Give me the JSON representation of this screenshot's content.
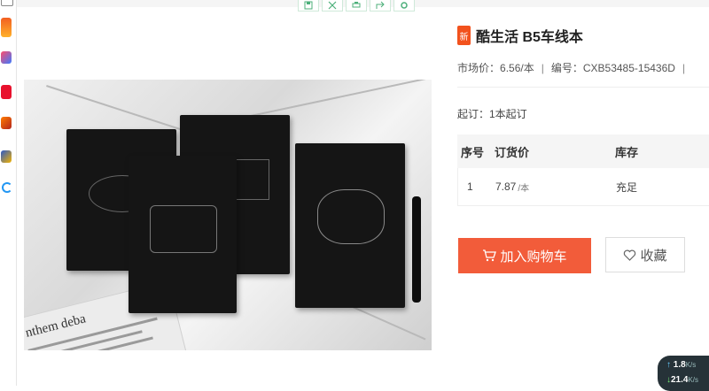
{
  "product": {
    "badge": "新",
    "title": "酷生活 B5车线本",
    "market_price_label": "市场价：",
    "market_price": "6.56",
    "price_unit": "/本",
    "separator": "|",
    "code_label": "编号：",
    "code": "CXB53485-15436D",
    "moq": "起订：1本起订"
  },
  "price_table": {
    "headers": [
      "序号",
      "订货价",
      "库存"
    ],
    "rows": [
      {
        "index": "1",
        "price": "7.87",
        "unit": "/本",
        "stock": "充足"
      }
    ]
  },
  "actions": {
    "add_to_cart": "加入购物车",
    "favorite": "收藏"
  },
  "image_tools": [
    "save-icon",
    "expand-icon",
    "print-icon",
    "share-icon",
    "settings-icon"
  ],
  "image": {
    "newspaper_headline": "nthem deba"
  },
  "network": {
    "up": "1.8",
    "up_unit": "K/s",
    "down": "21.4",
    "down_unit": "K/s"
  },
  "colors": {
    "accent": "#f25c3a",
    "badge": "#f2521d"
  }
}
